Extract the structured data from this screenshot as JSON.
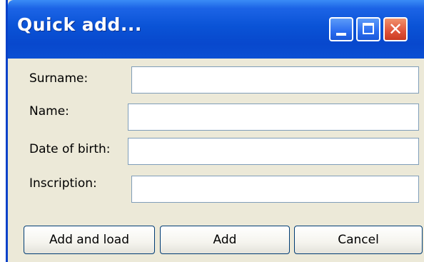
{
  "window": {
    "title": "Quick add..."
  },
  "titlebar_buttons": {
    "minimize_icon": "minimize-icon",
    "maximize_icon": "maximize-icon",
    "close_icon": "close-icon",
    "close_glyph": "✕"
  },
  "form": {
    "surname_label": "Surname:",
    "surname_value": "",
    "name_label": "Name:",
    "name_value": "",
    "dob_label": "Date of birth:",
    "dob_value": "",
    "inscription_label": "Inscription:",
    "inscription_value": ""
  },
  "buttons": {
    "add_and_load": "Add and load",
    "add": "Add",
    "cancel": "Cancel"
  },
  "colors": {
    "titlebar": "#0a53d6",
    "window_bg": "#ece9d8",
    "close_button": "#e0533a"
  }
}
